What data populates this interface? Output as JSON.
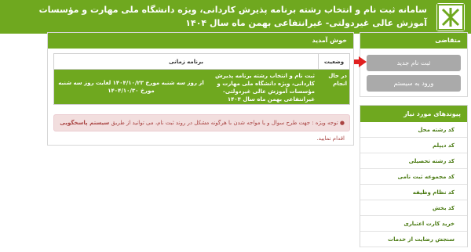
{
  "header": {
    "title": "سامانه ثبت نام و انتخاب رشته برنامه پذیرش کاردانی، ویژه دانشگاه ملی مهارت و مؤسسات آموزش عالی غیردولتی- غیرانتفاعی بهمن ماه سال ۱۴۰۴"
  },
  "applicant": {
    "heading": "متقاضی",
    "new_signup": "ثبت نام جدید",
    "login": "ورود به سیستم"
  },
  "links": {
    "heading": "پیوندهای مورد نیاز",
    "items": [
      "کد رشته محل",
      "کد دیپلم",
      "کد رشته تحصیلی",
      "کد مجموعه ثبت نامی",
      "کد نظام وظیفه",
      "کد بخش",
      "خرید کارت اعتباری",
      "سنجش رضایت از خدمات"
    ]
  },
  "main": {
    "heading": "خوش آمدید",
    "table": {
      "col_status": "وضعیت",
      "col_schedule": "برنامه زمانی",
      "row_status": "در حال انجام",
      "row_title": "ثبت نام و انتخاب رشته برنامه پذیرش کاردانی، ویژه دانشگاه ملی مهارت و مؤسسات آموزش عالی غیردولتی- غیرانتفاعی بهمن ماه سال ۱۴۰۴",
      "row_time": "از روز سه شنبه مورخ ۱۴۰۴/۱۰/۲۳ لغایت روز سه شنبه مورخ ۱۴۰۴/۱۰/۳۰"
    },
    "alert": {
      "text": "توجه ویژه : جهت طرح سوال و یا مواجه شدن با هرگونه مشکل در روند ثبت نام، می توانید از طریق",
      "link": "سیستم پاسخگویی",
      "suffix": "اقدام نمایید."
    }
  },
  "colors": {
    "brand": "#6fa81f",
    "alert": "#f2dede",
    "arrow": "#e02020"
  }
}
